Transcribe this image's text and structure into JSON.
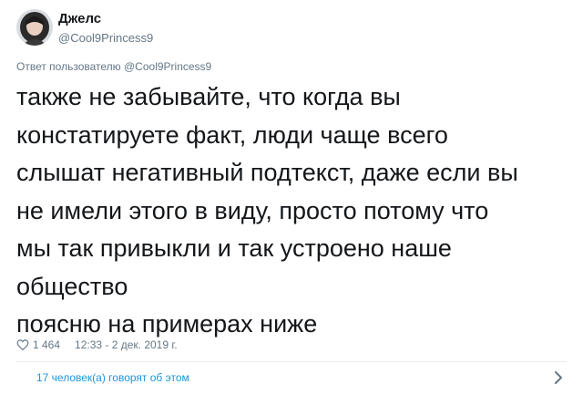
{
  "author": {
    "display_name": "Джелс",
    "handle": "@Cool9Princess9",
    "avatar_icon": "user-avatar-icon"
  },
  "reply_context": "Ответ пользователю @Cool9Princess9",
  "tweet": {
    "text": "также не забывайте, что когда вы\nконстатируете факт, люди чаще всего\nслышат негативный подтекст, даже если вы\nне имели этого в виду, просто потому что\nмы так привыкли и так устроено наше\nобщество\nпоясню на примерах ниже"
  },
  "meta": {
    "like_icon": "heart-icon",
    "likes": "1 464",
    "timestamp": "12:33 - 2 дек. 2019 г."
  },
  "conversation": {
    "label": "17 человек(а) говорят об этом",
    "chevron_icon": "chevron-right-icon"
  },
  "colors": {
    "text": "#14171a",
    "secondary": "#657786",
    "link": "#1b95e0",
    "divider": "#e6ecf0"
  }
}
